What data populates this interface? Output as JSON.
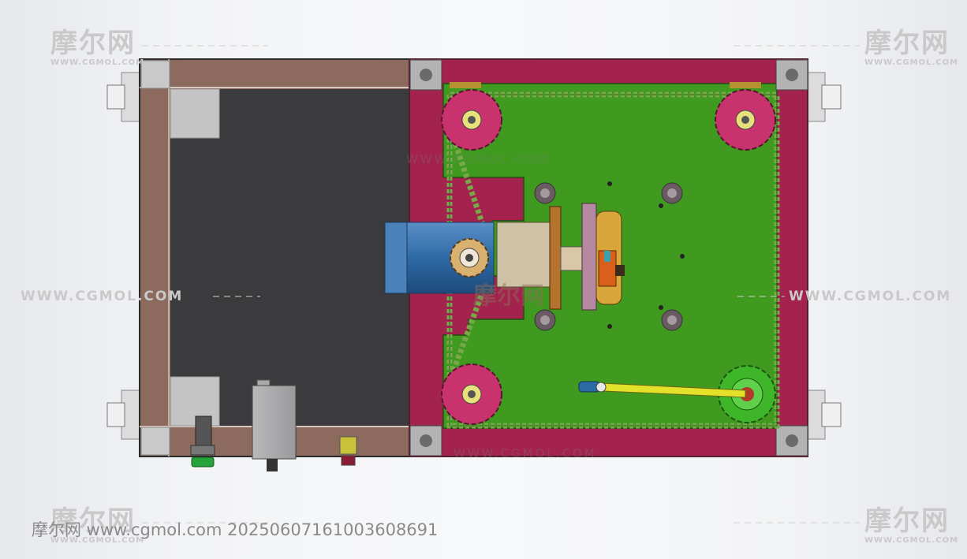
{
  "watermark": {
    "logo_text": "摩尔网",
    "logo_sub": "WWW.CGMOL.COM",
    "url_text": "WWW.CGMOL.COM"
  },
  "footer": {
    "text": "摩尔网 www.cgmol.com 20250607161003608691"
  },
  "colors": {
    "background": "#f3f4f6",
    "frame_brown": "#8d6a5e",
    "dark_panel": "#3b3b3d",
    "base_plate_crimson": "#a3224e",
    "mount_plate_green": "#3f9a1f",
    "motor_blue": "#2e6aa6",
    "sprocket_pink": "#c8336e",
    "drive_sprocket_green": "#3fb52a",
    "arm_yellow": "#e3e12a",
    "chain_green": "#77a84a"
  },
  "icons": {
    "emergency_button": "green-button-icon",
    "indicator_light": "red-light-icon"
  }
}
